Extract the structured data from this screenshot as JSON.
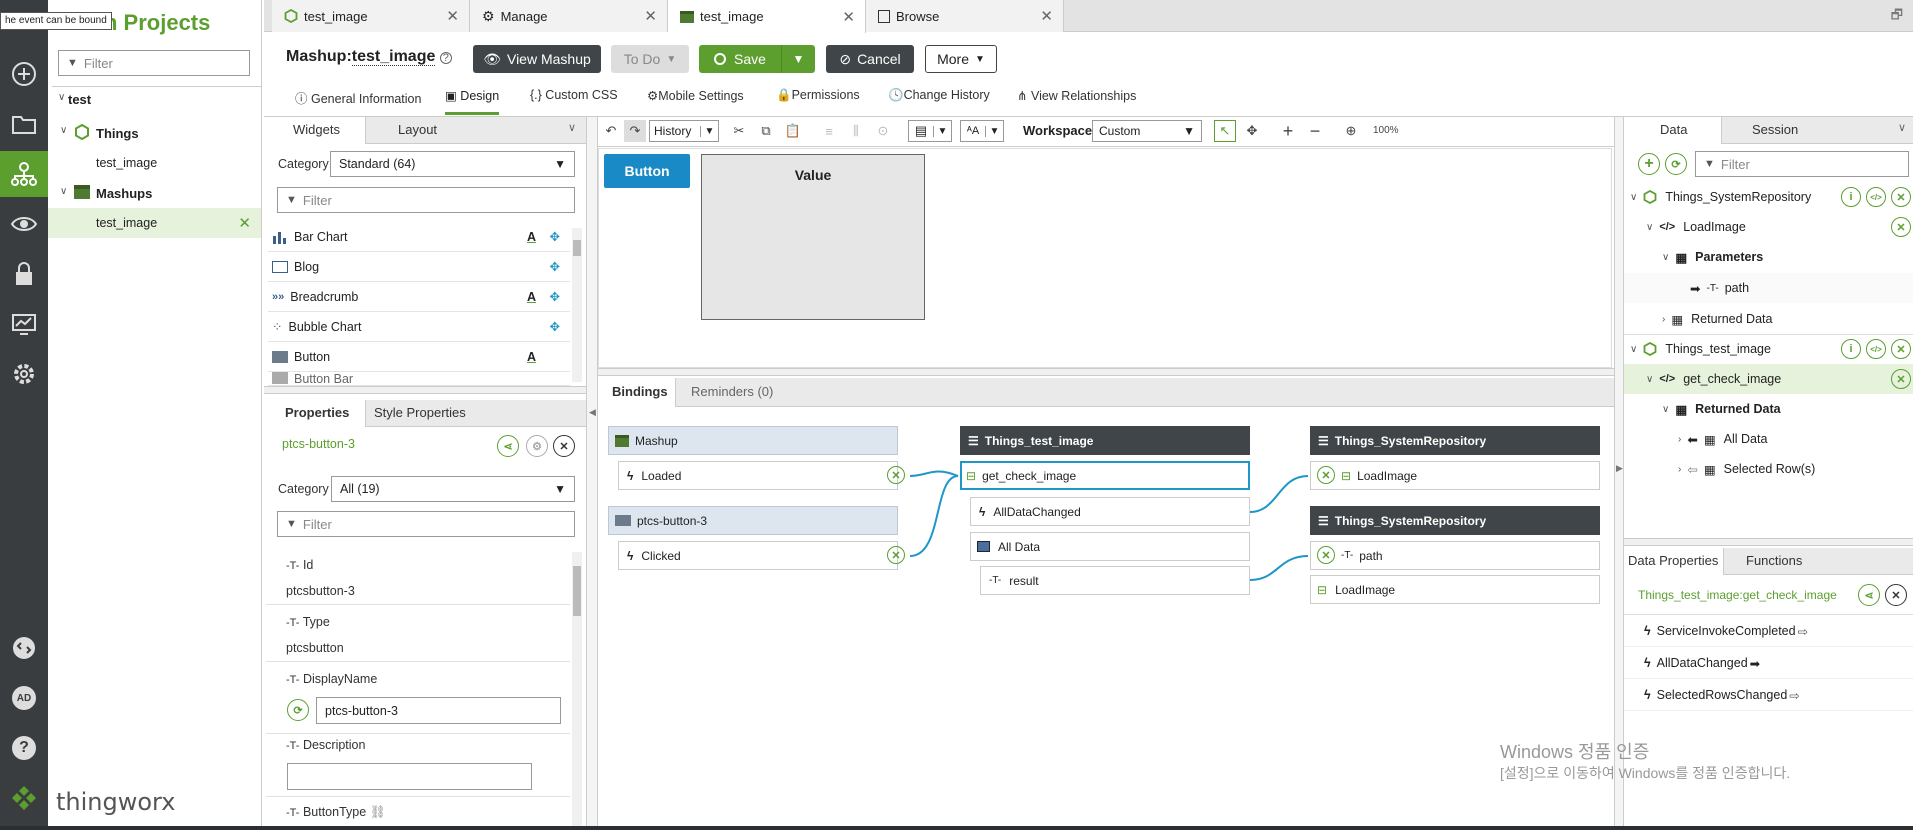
{
  "tooltip": "he event can be bound",
  "projects": {
    "title": "n Projects",
    "filter_placeholder": "Filter",
    "tree": {
      "root": "test",
      "things": "Things",
      "things_child": "test_image",
      "mashups": "Mashups",
      "mashups_child": "test_image"
    },
    "logo": "thingworx"
  },
  "left_avatar": "AD",
  "tabs": [
    {
      "label": "test_image"
    },
    {
      "label": "Manage"
    },
    {
      "label": "test_image"
    },
    {
      "label": "Browse"
    }
  ],
  "header": {
    "prefix": "Mashup:",
    "name": "test_image",
    "view_mashup": "View Mashup",
    "todo": "To Do",
    "save": "Save",
    "cancel": "Cancel",
    "more": "More"
  },
  "subtabs": [
    "General Information",
    "Design",
    "Custom CSS",
    "Mobile Settings",
    "Permissions",
    "Change History",
    "View Relationships"
  ],
  "widgets_panel": {
    "tab1": "Widgets",
    "tab2": "Layout",
    "category_label": "Category",
    "category_value": "Standard (64)",
    "filter": "Filter",
    "items": [
      "Bar Chart",
      "Blog",
      "Breadcrumb",
      "Bubble Chart",
      "Button",
      "Button Bar"
    ]
  },
  "props_panel": {
    "tab1": "Properties",
    "tab2": "Style Properties",
    "widget_id": "ptcs-button-3",
    "category_label": "Category",
    "category_value": "All (19)",
    "filter": "Filter",
    "id_label": "Id",
    "id_value": "ptcsbutton-3",
    "type_label": "Type",
    "type_value": "ptcsbutton",
    "displayname_label": "DisplayName",
    "displayname_value": "ptcs-button-3",
    "description_label": "Description",
    "buttontype_label": "ButtonType"
  },
  "toolbar": {
    "history": "History",
    "workspace_label": "Workspace",
    "workspace_value": "Custom",
    "zoom": "100%"
  },
  "canvas": {
    "button_label": "Button",
    "value_label": "Value"
  },
  "bindings_panel": {
    "tab1": "Bindings",
    "tab2": "Reminders (0)",
    "mashup": "Mashup",
    "loaded": "Loaded",
    "widget": "ptcs-button-3",
    "clicked": "Clicked",
    "thing": "Things_test_image",
    "service": "get_check_image",
    "alldatachanged": "AllDataChanged",
    "alldata": "All Data",
    "result": "result",
    "repo1": "Things_SystemRepository",
    "loadimage1": "LoadImage",
    "repo2": "Things_SystemRepository",
    "path": "path",
    "loadimage2": "LoadImage"
  },
  "data_panel": {
    "tab1": "Data",
    "tab2": "Session",
    "filter": "Filter",
    "repo": "Things_SystemRepository",
    "loadimage": "LoadImage",
    "parameters": "Parameters",
    "path": "path",
    "returned1": "Returned Data",
    "thing": "Things_test_image",
    "service": "get_check_image",
    "returned2": "Returned Data",
    "alldata": "All Data",
    "selectedrows": "Selected Row(s)"
  },
  "data_props": {
    "tab1": "Data Properties",
    "tab2": "Functions",
    "service_path": "Things_test_image:get_check_image",
    "events": [
      "ServiceInvokeCompleted",
      "AllDataChanged",
      "SelectedRowsChanged"
    ]
  },
  "watermark": {
    "line1": "Windows 정품 인증",
    "line2": "[설정]으로 이동하여 Windows를 정품 인증합니다."
  },
  "colors": {
    "brand_green": "#5c9f2f",
    "sidebar_dark": "#3a3d3f",
    "button_blue": "#1a8ac6",
    "binding_line": "#1e96c8"
  }
}
